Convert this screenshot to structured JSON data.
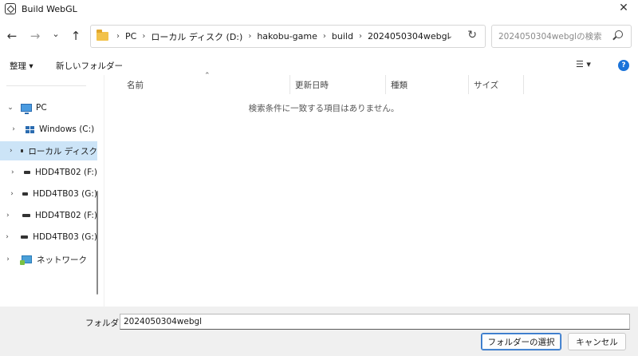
{
  "window": {
    "title": "Build WebGL",
    "close_glyph": "✕"
  },
  "nav": {
    "back_glyph": "←",
    "forward_glyph": "→",
    "recent_glyph": "⌄",
    "up_glyph": "↑",
    "breadcrumbs": [
      "PC",
      "ローカル ディスク (D:)",
      "hakobu-game",
      "build",
      "2024050304webgl"
    ],
    "crumb_sep": "›",
    "dropdown_glyph": "⌄",
    "refresh_glyph": "↻",
    "search_placeholder": "2024050304webglの検索"
  },
  "toolbar": {
    "organize_label": "整理 ▾",
    "new_folder_label": "新しいフォルダー",
    "view_label": "☰ ▾",
    "help_label": "?"
  },
  "sidebar": {
    "items": [
      {
        "label": "PC",
        "chevron": "⌄"
      },
      {
        "label": "Windows (C:)",
        "chevron": "›"
      },
      {
        "label": "ローカル ディスク",
        "chevron": "›"
      },
      {
        "label": "HDD4TB02 (F:)",
        "chevron": "›"
      },
      {
        "label": "HDD4TB03 (G:)",
        "chevron": "›"
      },
      {
        "label": "HDD4TB02 (F:)",
        "chevron": "›"
      },
      {
        "label": "HDD4TB03 (G:)",
        "chevron": "›"
      },
      {
        "label": "ネットワーク",
        "chevron": "›"
      }
    ]
  },
  "content": {
    "columns": [
      "名前",
      "更新日時",
      "種類",
      "サイズ"
    ],
    "sort_glyph": "⌃",
    "empty_message": "検索条件に一致する項目はありません。"
  },
  "footer": {
    "folder_label": "フォルダー:",
    "folder_value": "2024050304webgl",
    "select_button": "フォルダーの選択",
    "cancel_button": "キャンセル"
  }
}
